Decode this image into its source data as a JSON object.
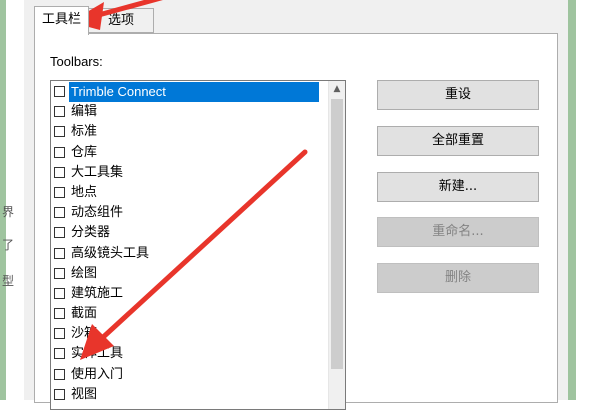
{
  "background": {
    "left_fragments": [
      "界",
      "了",
      "型"
    ]
  },
  "tabs": [
    {
      "label": "工具栏",
      "active": true
    },
    {
      "label": "选项",
      "active": false
    }
  ],
  "toolbars_label": "Toolbars:",
  "toolbar_items": [
    {
      "label": "Trimble Connect",
      "checked": false,
      "selected": true
    },
    {
      "label": "编辑",
      "checked": false
    },
    {
      "label": "标准",
      "checked": false
    },
    {
      "label": "仓库",
      "checked": false
    },
    {
      "label": "大工具集",
      "checked": false
    },
    {
      "label": "地点",
      "checked": false
    },
    {
      "label": "动态组件",
      "checked": false
    },
    {
      "label": "分类器",
      "checked": false
    },
    {
      "label": "高级镜头工具",
      "checked": false
    },
    {
      "label": "绘图",
      "checked": false
    },
    {
      "label": "建筑施工",
      "checked": false
    },
    {
      "label": "截面",
      "checked": false
    },
    {
      "label": "沙箱",
      "checked": false
    },
    {
      "label": "实体工具",
      "checked": false
    },
    {
      "label": "使用入门",
      "checked": false
    },
    {
      "label": "视图",
      "checked": false
    }
  ],
  "buttons": {
    "reset": "重设",
    "reset_all": "全部重置",
    "new": "新建...",
    "rename": "重命名...",
    "delete": "删除"
  },
  "colors": {
    "selection": "#0078d7",
    "annotation_arrow": "#e8352b",
    "dialog_bg": "#f0f0f0"
  }
}
